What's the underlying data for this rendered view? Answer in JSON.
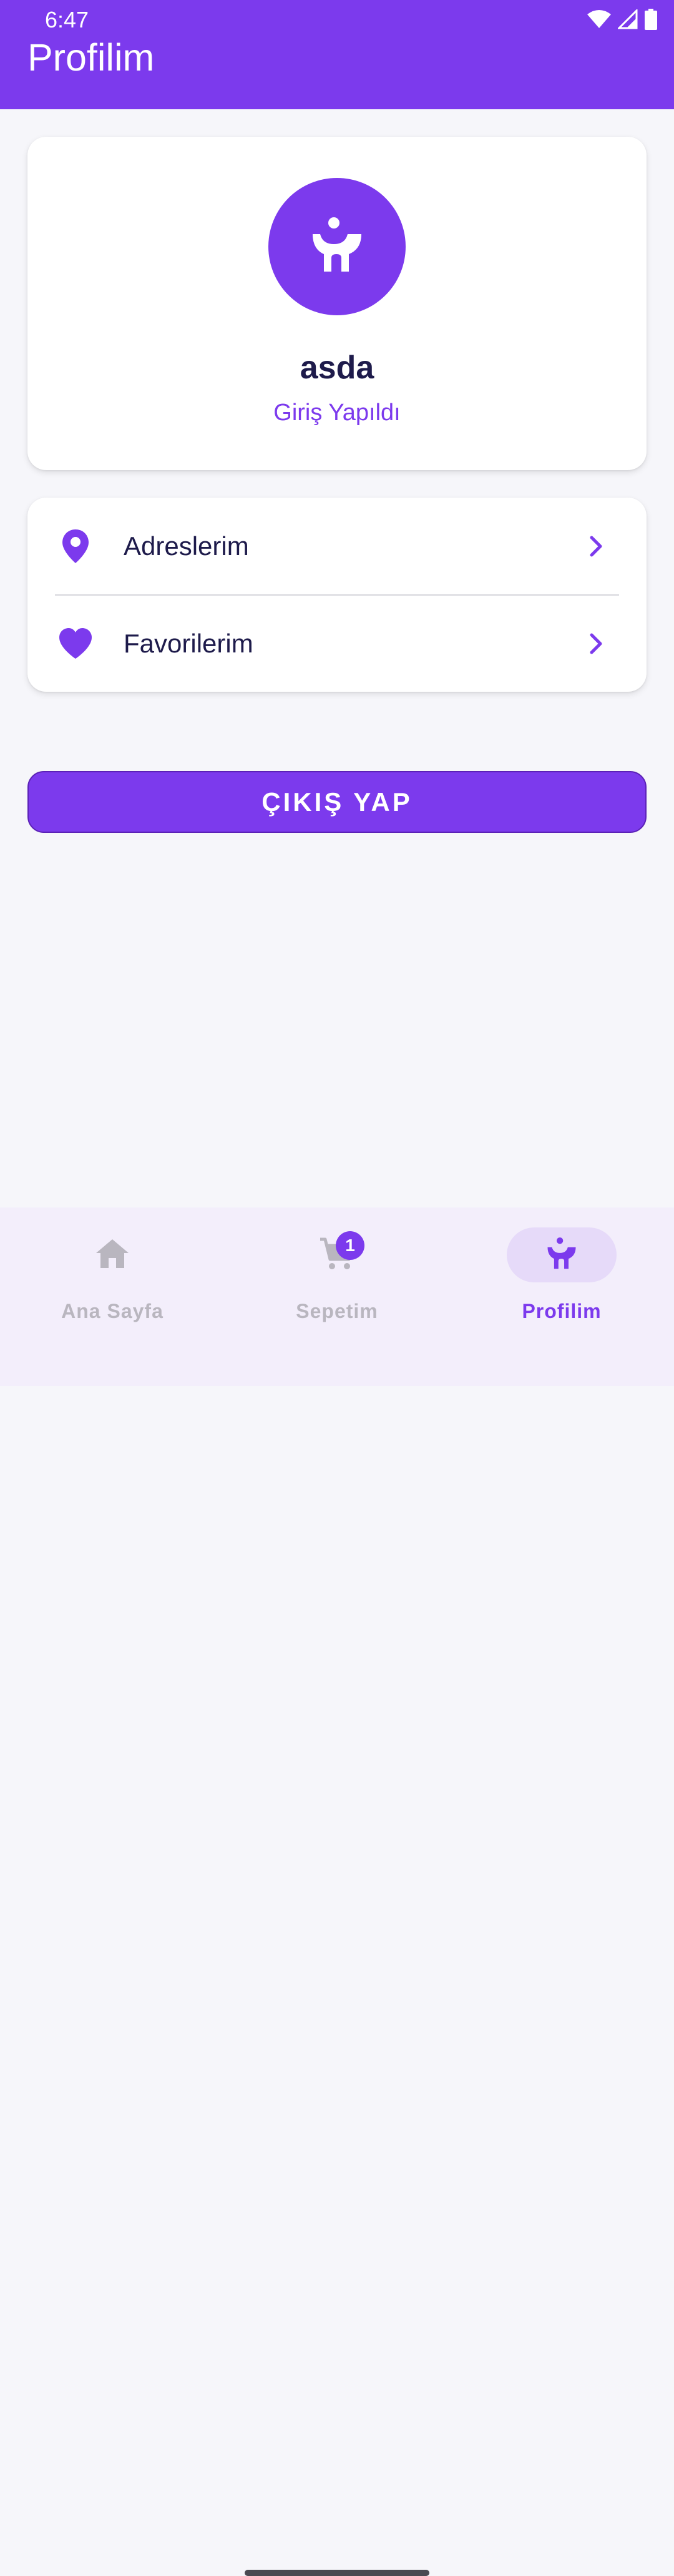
{
  "status_bar": {
    "time": "6:47",
    "icons": [
      "wifi-icon",
      "signal-icon",
      "battery-icon"
    ]
  },
  "app_bar": {
    "title": "Profilim"
  },
  "profile": {
    "avatar_icon": "profile-person-icon",
    "name": "asda",
    "status": "Giriş Yapıldı"
  },
  "menu": {
    "items": [
      {
        "label": "Adreslerim",
        "icon": "location-pin-icon"
      },
      {
        "label": "Favorilerim",
        "icon": "heart-icon"
      }
    ]
  },
  "logout": {
    "label": "ÇIKIŞ YAP"
  },
  "bottom_nav": {
    "items": [
      {
        "label": "Ana Sayfa",
        "icon": "home-icon",
        "active": false
      },
      {
        "label": "Sepetim",
        "icon": "cart-icon",
        "active": false,
        "badge": "1"
      },
      {
        "label": "Profilim",
        "icon": "profile-person-icon",
        "active": true
      }
    ]
  },
  "colors": {
    "primary": "#7C3AED",
    "background": "#F6F6FA",
    "text_dark": "#1E1B4B",
    "nav_background": "#F3EEFB",
    "nav_inactive": "#B9B6BF"
  }
}
